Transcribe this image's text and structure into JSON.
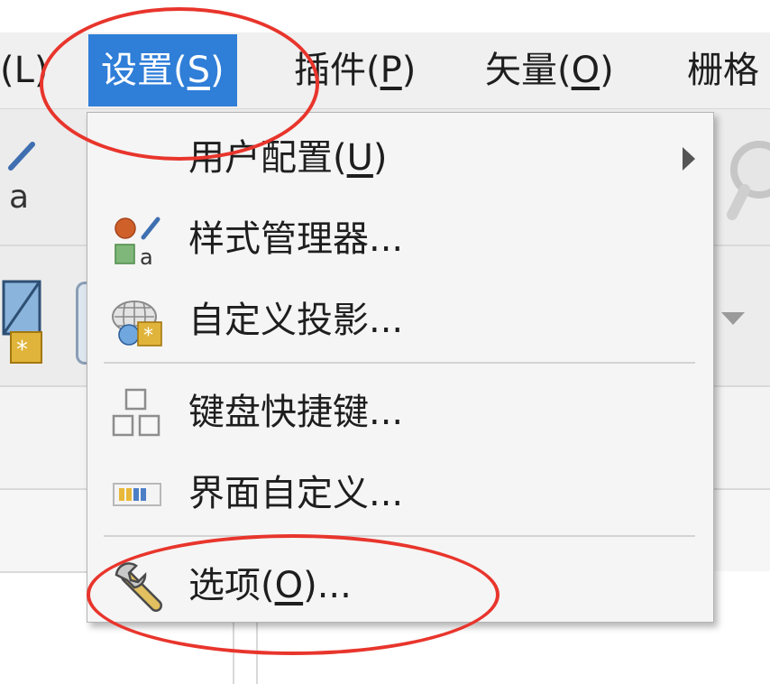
{
  "menubar": {
    "items": [
      {
        "name": "layer",
        "label": "(L)",
        "partial": true
      },
      {
        "name": "settings",
        "base": "设置(",
        "key": "S",
        "tail": ")",
        "active": true
      },
      {
        "name": "plugins",
        "base": "插件(",
        "key": "P",
        "tail": ")"
      },
      {
        "name": "vector",
        "base": "矢量(",
        "key": "O",
        "tail": ")"
      },
      {
        "name": "raster",
        "label": "栅格",
        "partial": true
      }
    ]
  },
  "settings_menu": {
    "items": [
      {
        "name": "user-profiles",
        "base": "用户配置(",
        "key": "U",
        "tail": ")",
        "icon": "none",
        "has_submenu": true
      },
      {
        "name": "style-manager",
        "label": "样式管理器...",
        "icon": "style-manager-icon"
      },
      {
        "name": "custom-projections",
        "label": "自定义投影...",
        "icon": "globe-projection-icon"
      },
      {
        "separator": true
      },
      {
        "name": "keyboard-shortcuts",
        "label": "键盘快捷键...",
        "icon": "keyboard-shortcuts-icon"
      },
      {
        "name": "interface-customization",
        "label": "界面自定义...",
        "icon": "interface-customize-icon"
      },
      {
        "separator": true
      },
      {
        "name": "options",
        "base": "选项(",
        "key": "O",
        "tail": ")...",
        "icon": "wrench-icon"
      }
    ]
  },
  "highlights": [
    {
      "name": "settings-menu-highlight",
      "color": "#e8352c"
    },
    {
      "name": "options-item-highlight",
      "color": "#e8352c"
    }
  ],
  "colors": {
    "accent": "#2f7ed8",
    "menu_bg": "#f5f5f5",
    "annotation_red": "#e8352c"
  }
}
